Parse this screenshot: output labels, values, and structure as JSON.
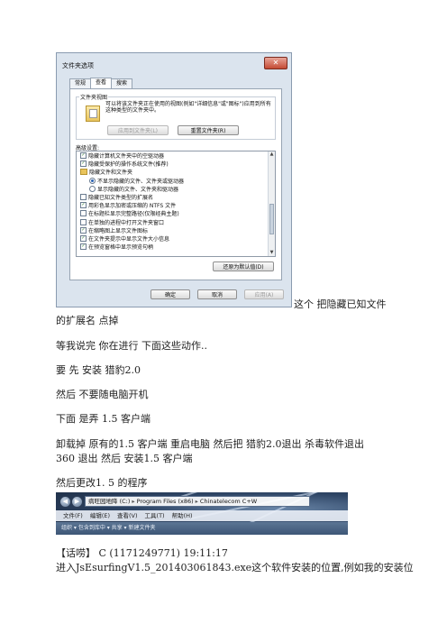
{
  "dialog": {
    "title": "文件夹选项",
    "close_glyph": "✕",
    "tabs": [
      "常规",
      "查看",
      "搜索"
    ],
    "folder_views_label": "文件夹视图",
    "folder_views_desc": "可以将该文件夹正在使用的视图(例如\"详细信息\"或\"图标\")应用到所有这种类型的文件夹中。",
    "apply_to_folders": "应用到文件夹(L)",
    "reset_folders": "重置文件夹(R)",
    "advanced_label": "高级设置:",
    "tree_items": [
      {
        "kind": "check",
        "checked": true,
        "indent": 0,
        "text": "隐藏计算机文件夹中的空驱动器"
      },
      {
        "kind": "check",
        "checked": true,
        "indent": 0,
        "text": "隐藏受保护的操作系统文件(推荐)"
      },
      {
        "kind": "folder",
        "indent": 0,
        "text": "隐藏文件和文件夹"
      },
      {
        "kind": "radio",
        "on": true,
        "indent": 1,
        "text": "不显示隐藏的文件、文件夹或驱动器"
      },
      {
        "kind": "radio",
        "on": false,
        "indent": 1,
        "text": "显示隐藏的文件、文件夹和驱动器"
      },
      {
        "kind": "check",
        "checked": false,
        "indent": 0,
        "text": "隐藏已知文件类型的扩展名"
      },
      {
        "kind": "check",
        "checked": true,
        "indent": 0,
        "text": "用彩色显示加密或压缩的 NTFS 文件"
      },
      {
        "kind": "check",
        "checked": false,
        "indent": 0,
        "text": "在标题栏显示完整路径(仅限经典主题)"
      },
      {
        "kind": "check",
        "checked": false,
        "indent": 0,
        "text": "在单独的进程中打开文件夹窗口"
      },
      {
        "kind": "check",
        "checked": true,
        "indent": 0,
        "text": "在缩略图上显示文件图标"
      },
      {
        "kind": "check",
        "checked": true,
        "indent": 0,
        "text": "在文件夹提示中显示文件大小信息"
      },
      {
        "kind": "check",
        "checked": true,
        "indent": 0,
        "text": "在预览窗格中显示预览句柄"
      }
    ],
    "restore_defaults": "还原为默认值(D)",
    "ok": "确定",
    "cancel": "取消",
    "apply": "应用(A)"
  },
  "paragraphs": {
    "p1a": "这个 把隐藏已知文件",
    "p1b": "的扩展名 点掉",
    "p2": "等我说完    你在进行 下面这些动作..",
    "p3": "要 先 安装 猎豹2.0",
    "p4": "然后 不要随电脑开机",
    "p5": "下面 是弄 1.5 客户端",
    "p6a": "卸载掉 原有的1.5  客户端 重启电脑  然后把 猎豹2.0退出  杀毒软件退出",
    "p6b": "360 退出  然后 安装1.5 客户端",
    "p7": "然后更改1. 5 的程序",
    "p8": "【话唠】     C     (1171249771) 19:11:17",
    "p9": "进入JsEsurfingV1.5_201403061843.exe这个软件安装的位置,例如我的安装位"
  },
  "explorer": {
    "path": [
      "病旺园地降 (C:)",
      "Program Files (x86)",
      "Chinatelecom C+W"
    ],
    "menu": [
      "文件(F)",
      "编辑(E)",
      "查看(V)",
      "工具(T)",
      "帮助(H)"
    ],
    "toolbar": "组织 ▾     包含到库中 ▾     共享 ▾     新建文件夹"
  }
}
